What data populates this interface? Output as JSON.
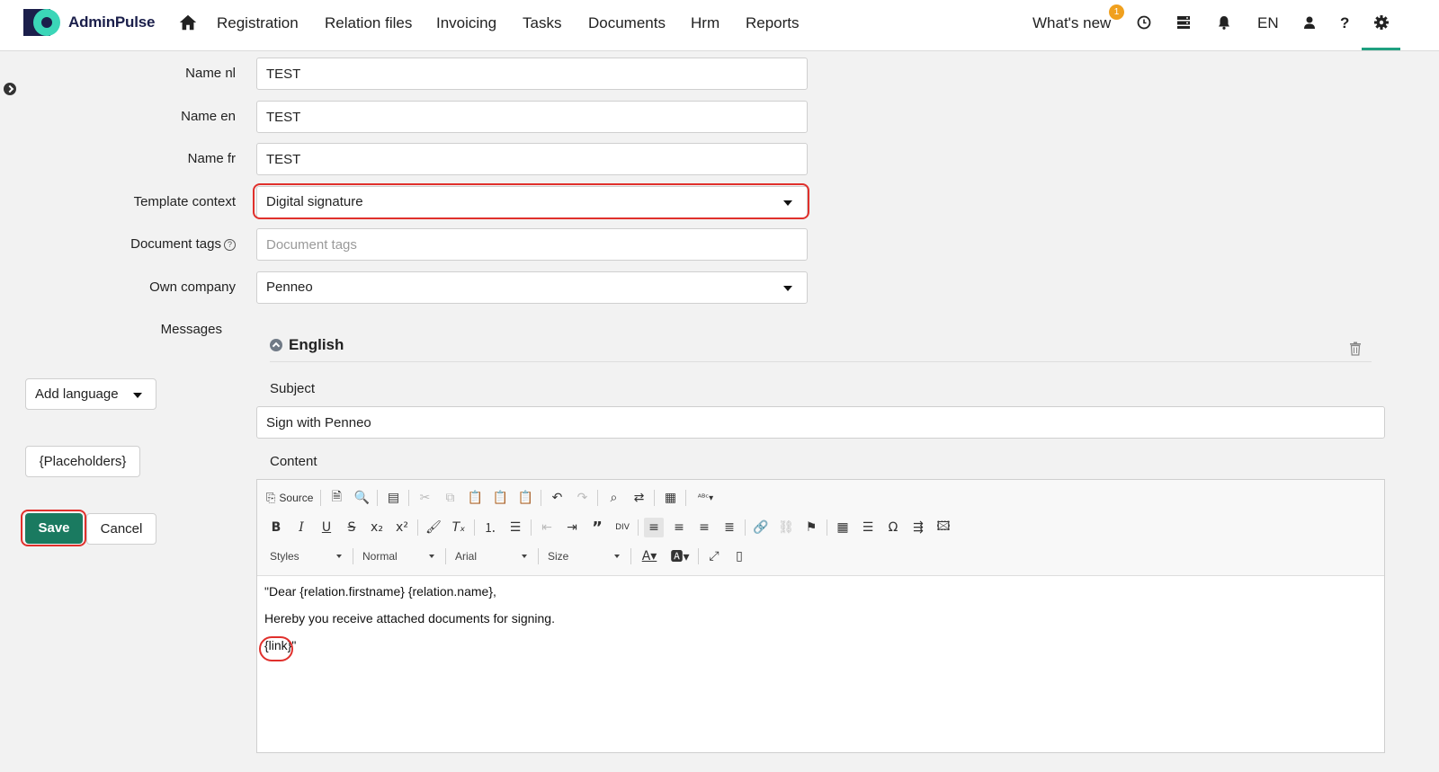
{
  "app": {
    "brand": "AdminPulse",
    "colors": {
      "brand_dark": "#1b1f4b",
      "brand_accent": "#3bd6b8",
      "primary": "#1a7a60",
      "highlight": "#e0302c",
      "badge": "#f0a01e"
    }
  },
  "nav": {
    "home_icon": "home-icon",
    "items": [
      "Registration",
      "Relation files",
      "Invoicing",
      "Tasks",
      "Documents",
      "Hrm",
      "Reports"
    ],
    "whats_new": "What's new",
    "whats_new_badge": "1",
    "language": "EN",
    "icons": [
      "clock-icon",
      "server-icon",
      "bell-icon",
      "user-icon",
      "help-icon",
      "gear-icon"
    ],
    "help_label": "?"
  },
  "form": {
    "name_nl": {
      "label": "Name nl",
      "value": "TEST"
    },
    "name_en": {
      "label": "Name en",
      "value": "TEST"
    },
    "name_fr": {
      "label": "Name fr",
      "value": "TEST"
    },
    "template_context": {
      "label": "Template context",
      "value": "Digital signature"
    },
    "document_tags": {
      "label": "Document tags",
      "placeholder": "Document tags",
      "help": "?"
    },
    "own_company": {
      "label": "Own company",
      "value": "Penneo"
    },
    "messages_label": "Messages"
  },
  "sidebar": {
    "add_language": "Add language",
    "placeholders": "{Placeholders}",
    "save": "Save",
    "cancel": "Cancel"
  },
  "message": {
    "language": "English",
    "subject_label": "Subject",
    "subject_value": "Sign with Penneo",
    "content_label": "Content"
  },
  "editor": {
    "source_label": "Source",
    "styles": "Styles",
    "format": "Normal",
    "font": "Arial",
    "size": "Size",
    "content": [
      "\"Dear {relation.firstname} {relation.name},",
      "Hereby you receive attached documents for signing.",
      "{link}\""
    ]
  }
}
